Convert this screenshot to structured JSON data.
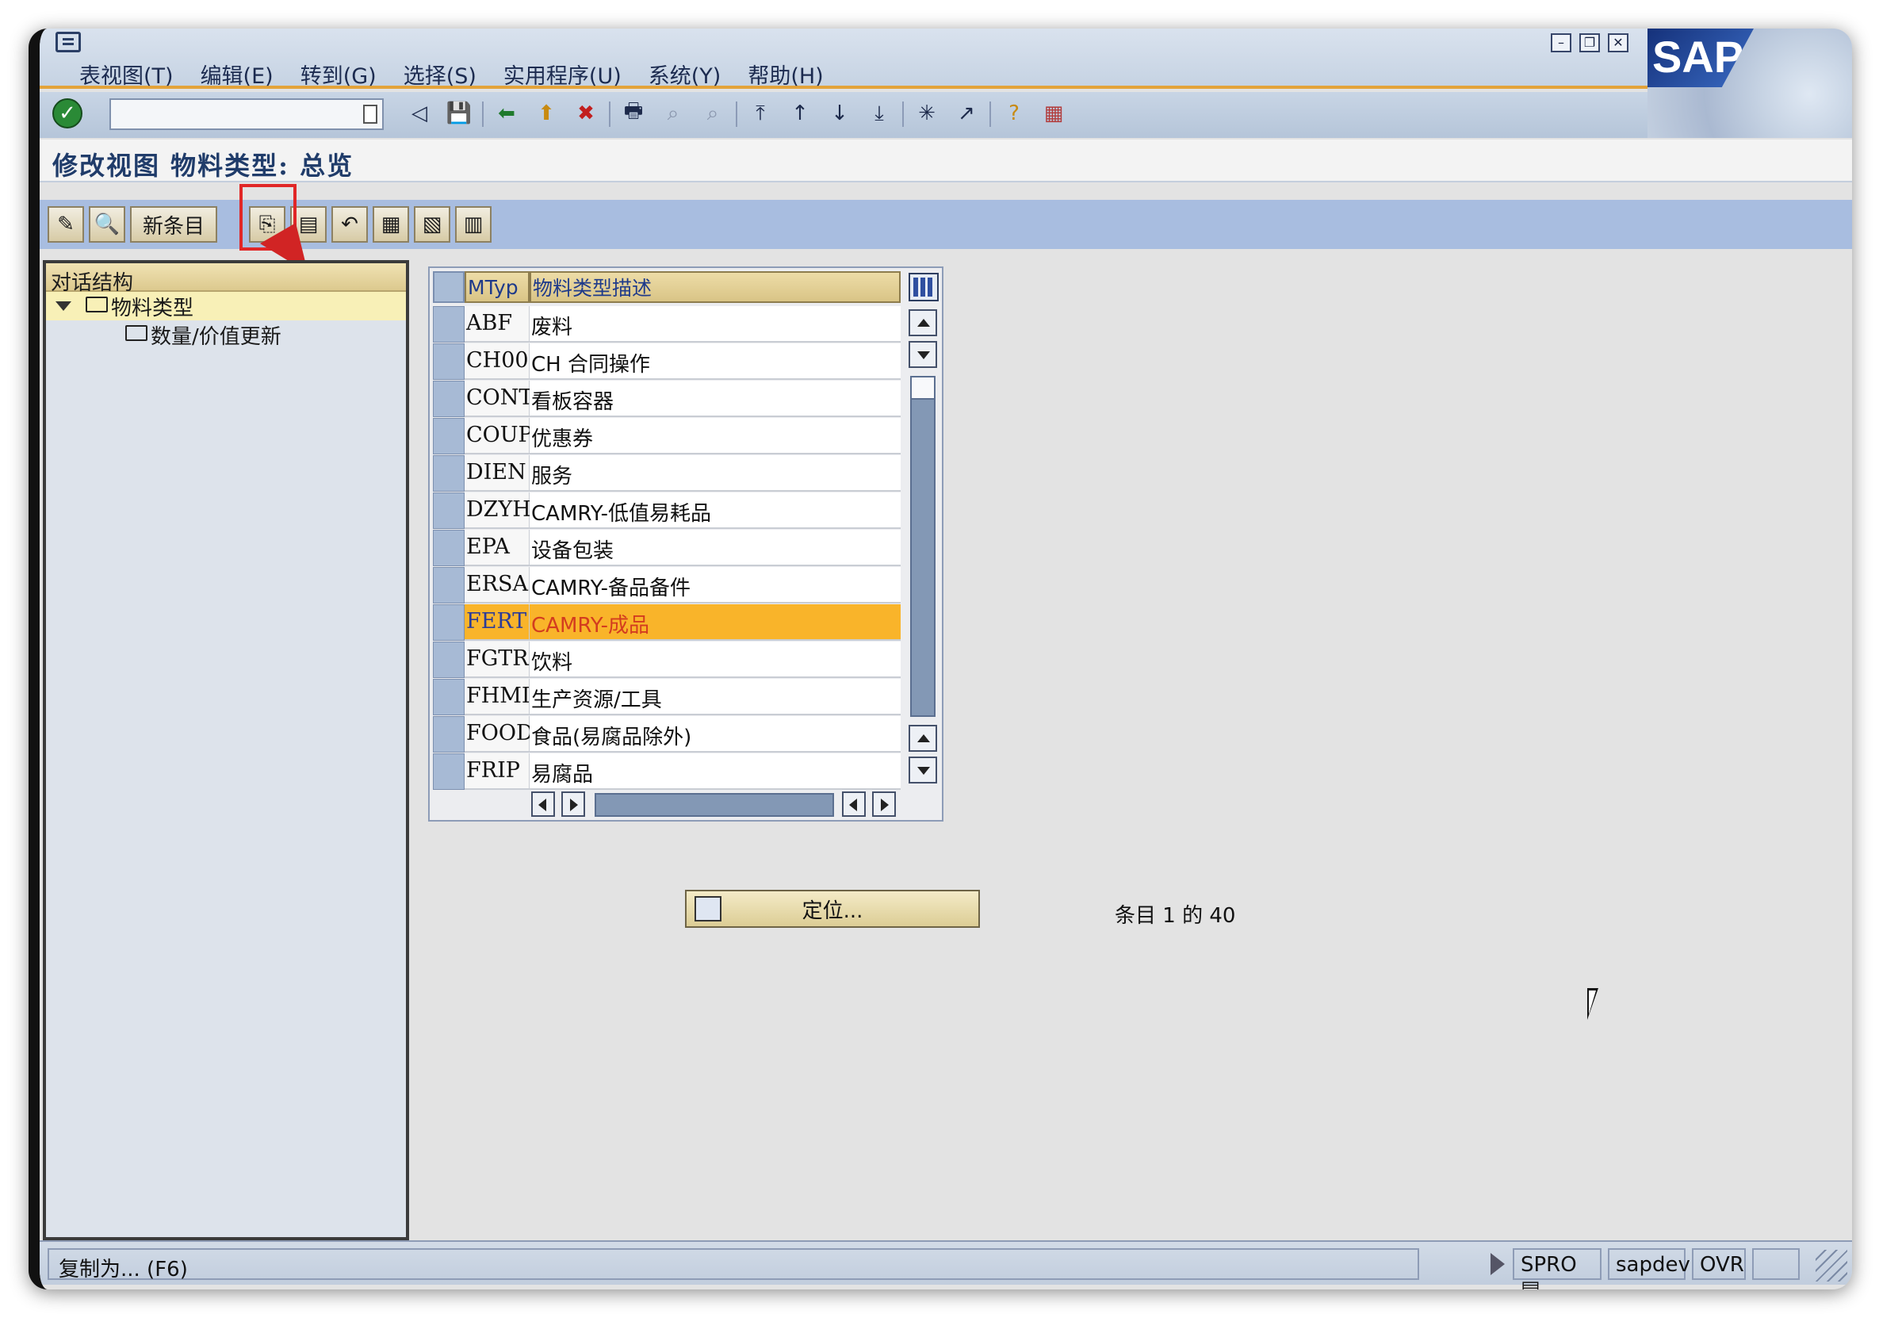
{
  "menubar": {
    "items": [
      "表视图(T)",
      "编辑(E)",
      "转到(G)",
      "选择(S)",
      "实用程序(U)",
      "系统(Y)",
      "帮助(H)"
    ],
    "logo": "SAP"
  },
  "toolbar": {
    "command_value": "",
    "icons": [
      "enter-icon",
      "back-icon",
      "save-icon",
      "green-back-icon",
      "exit-icon",
      "cancel-icon",
      "print-icon",
      "find-icon",
      "find-next-icon",
      "first-page-icon",
      "prev-page-icon",
      "next-page-icon",
      "last-page-icon",
      "new-session-icon",
      "shortcut-icon",
      "help-icon",
      "layout-icon"
    ]
  },
  "title": "修改视图 物料类型: 总览",
  "app_toolbar": {
    "new_entries": "新条目"
  },
  "dialog_structure": {
    "header": "对话结构",
    "root": "物料类型",
    "child": "数量/价值更新"
  },
  "table": {
    "columns": [
      "MTyp",
      "物料类型描述"
    ],
    "rows": [
      {
        "code": "ABF",
        "desc": "废料"
      },
      {
        "code": "CH00",
        "desc": "CH 合同操作"
      },
      {
        "code": "CONT",
        "desc": "看板容器"
      },
      {
        "code": "COUP",
        "desc": "优惠券"
      },
      {
        "code": "DIEN",
        "desc": "服务"
      },
      {
        "code": "DZYH",
        "desc": "CAMRY-低值易耗品"
      },
      {
        "code": "EPA",
        "desc": "设备包装"
      },
      {
        "code": "ERSA",
        "desc": "CAMRY-备品备件"
      },
      {
        "code": "FERT",
        "desc": "CAMRY-成品",
        "selected": true
      },
      {
        "code": "FGTR",
        "desc": "饮料"
      },
      {
        "code": "FHMI",
        "desc": "生产资源/工具"
      },
      {
        "code": "FOOD",
        "desc": "食品(易腐品除外)"
      },
      {
        "code": "FRIP",
        "desc": "易腐品"
      }
    ]
  },
  "position_button": "定位...",
  "entries_text": "条目 1 的 40",
  "status": {
    "message": "复制为...   (F6)",
    "transaction": "SPRO",
    "server": "sapdev",
    "mode": "OVR"
  }
}
